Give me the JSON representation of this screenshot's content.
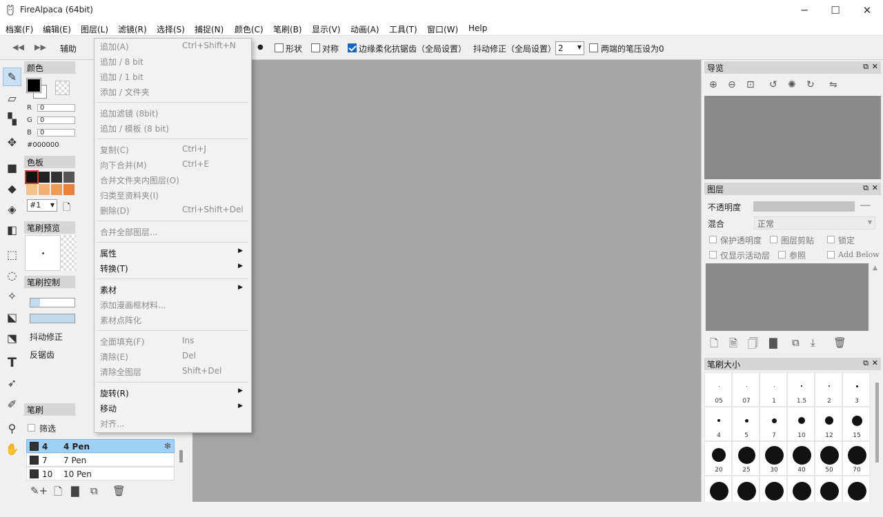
{
  "window": {
    "title": "FireAlpaca (64bit)",
    "minimize": "─",
    "maximize": "☐",
    "close": "✕"
  },
  "menubar": [
    "档案(F)",
    "编辑(E)",
    "图层(L)",
    "滤镜(R)",
    "选择(S)",
    "捕捉(N)",
    "颜色(C)",
    "笔刷(B)",
    "显示(V)",
    "动画(A)",
    "工具(T)",
    "窗口(W)",
    "Help"
  ],
  "toolbar": {
    "partial_label": "辅助",
    "shape_label": "形状",
    "symmetry_label": "对称",
    "antialias_label": "边缘柔化抗锯齿（全局设置）",
    "antialias_checked": true,
    "stabilizer_label": "抖动修正（全局设置）",
    "stabilizer_value": "2",
    "pressure_label": "两端的笔压设为0"
  },
  "left_panel": {
    "color_title": "颜色",
    "r_label": "R",
    "r_value": "0",
    "g_label": "G",
    "g_value": "0",
    "b_label": "B",
    "b_value": "0",
    "hex": "#000000",
    "palette_title": "色板",
    "palette_colors": [
      "#111111",
      "#222222",
      "#333333",
      "#555555",
      "#f5c28a",
      "#f3b071",
      "#ef9b55",
      "#e8813a"
    ],
    "palette_select": "#1",
    "brush_preview_title": "笔刷预览",
    "brush_control_title": "笔刷控制",
    "stabilizer_label": "抖动修正",
    "antialias_label": "反锯齿",
    "brush_title": "笔刷",
    "filter_label": "筛选",
    "brushes": [
      {
        "num": "4",
        "name": "4 Pen",
        "selected": true
      },
      {
        "num": "7",
        "name": "7 Pen",
        "selected": false
      },
      {
        "num": "10",
        "name": "10 Pen",
        "selected": false
      }
    ]
  },
  "layer_menu": {
    "items": [
      {
        "label": "追加(A)",
        "shortcut": "Ctrl+Shift+N",
        "enabled": false
      },
      {
        "label": "追加 / 8 bit",
        "shortcut": "",
        "enabled": false
      },
      {
        "label": "追加 / 1 bit",
        "shortcut": "",
        "enabled": false
      },
      {
        "label": "添加 / 文件夹",
        "shortcut": "",
        "enabled": false
      },
      {
        "label": "追加滤镜 (8bit)",
        "shortcut": "",
        "enabled": false
      },
      {
        "label": "追加 / 模板 (8 bit)",
        "shortcut": "",
        "enabled": false
      },
      {
        "label": "复制(C)",
        "shortcut": "Ctrl+J",
        "enabled": false
      },
      {
        "label": "向下合并(M)",
        "shortcut": "Ctrl+E",
        "enabled": false
      },
      {
        "label": "合并文件夹内图层(O)",
        "shortcut": "",
        "enabled": false
      },
      {
        "label": "归类至资料夹(I)",
        "shortcut": "",
        "enabled": false
      },
      {
        "label": "删除(D)",
        "shortcut": "Ctrl+Shift+Del",
        "enabled": false
      },
      {
        "label": "合并全部图层...",
        "shortcut": "",
        "enabled": false
      },
      {
        "label": "属性",
        "shortcut": "",
        "enabled": true,
        "submenu": true
      },
      {
        "label": "转换(T)",
        "shortcut": "",
        "enabled": true,
        "submenu": true
      },
      {
        "label": "素材",
        "shortcut": "",
        "enabled": true,
        "submenu": true
      },
      {
        "label": "添加漫画框材料...",
        "shortcut": "",
        "enabled": false
      },
      {
        "label": "素材点阵化",
        "shortcut": "",
        "enabled": false
      },
      {
        "label": "全面填充(F)",
        "shortcut": "Ins",
        "enabled": false
      },
      {
        "label": "清除(E)",
        "shortcut": "Del",
        "enabled": false
      },
      {
        "label": "清除全图层",
        "shortcut": "Shift+Del",
        "enabled": false
      },
      {
        "label": "旋转(R)",
        "shortcut": "",
        "enabled": true,
        "submenu": true
      },
      {
        "label": "移动",
        "shortcut": "",
        "enabled": true,
        "submenu": true
      },
      {
        "label": "对齐...",
        "shortcut": "",
        "enabled": false
      }
    ]
  },
  "navigator": {
    "title": "导览"
  },
  "layers": {
    "title": "图层",
    "opacity_label": "不透明度",
    "opacity_value": "──",
    "blend_label": "混合",
    "blend_value": "正常",
    "protect_alpha": "保护透明度",
    "clipping": "图层剪贴",
    "lock": "锁定",
    "show_active_only": "仅显示活动层",
    "reference": "参照",
    "add_below": "Add Below"
  },
  "brush_size": {
    "title": "笔刷大小",
    "sizes": [
      "05",
      "07",
      "1",
      "1.5",
      "2",
      "3",
      "4",
      "5",
      "7",
      "10",
      "12",
      "15",
      "20",
      "25",
      "30",
      "40",
      "50",
      "70",
      "",
      "",
      "",
      "",
      "",
      ""
    ]
  }
}
